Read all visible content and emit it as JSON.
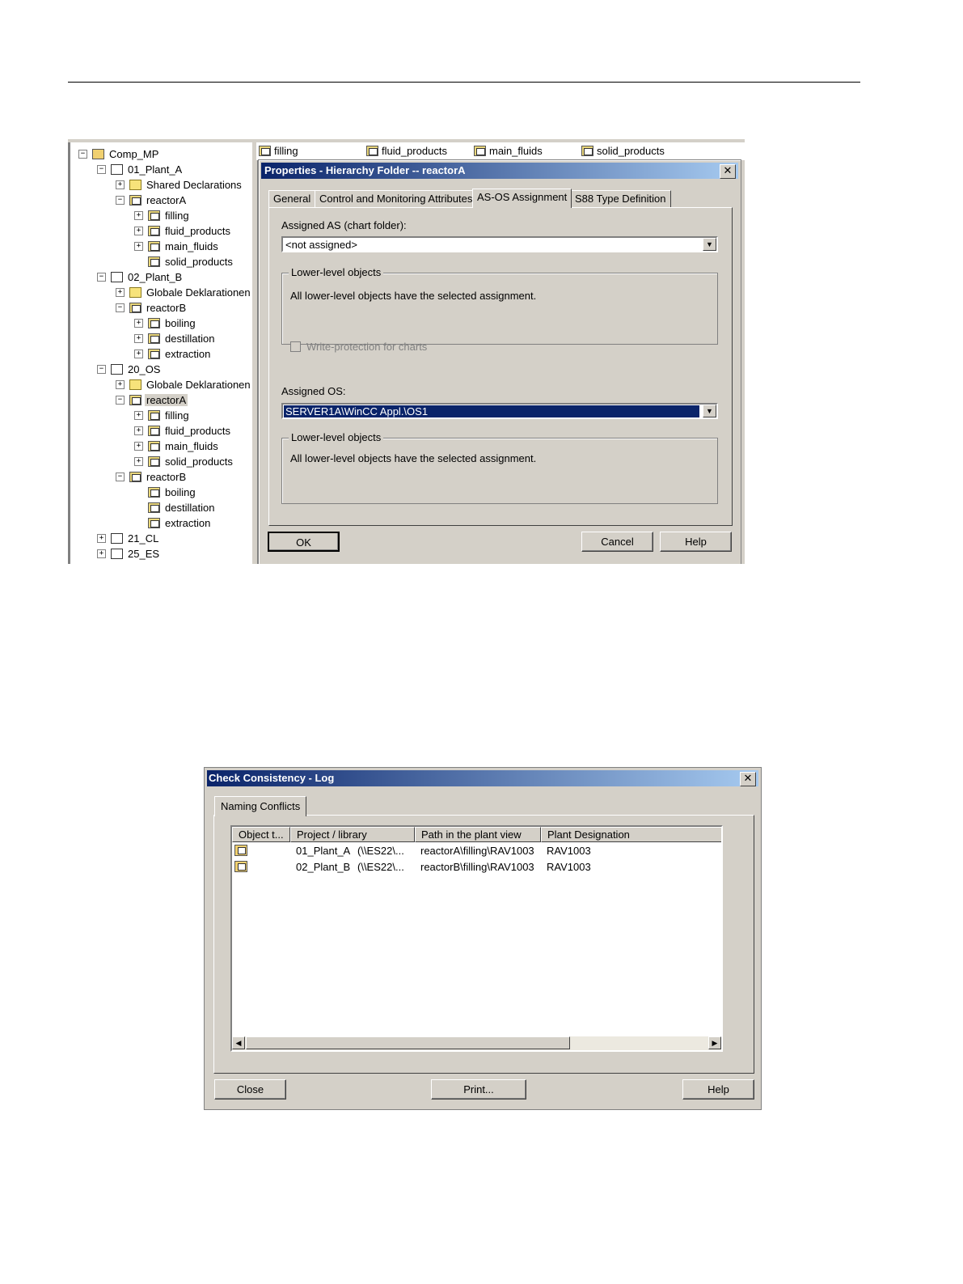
{
  "tree": {
    "items": [
      {
        "label": "Comp_MP",
        "level": 0,
        "toggle": "−",
        "icon": "project"
      },
      {
        "label": "01_Plant_A",
        "level": 1,
        "toggle": "−",
        "icon": "plant"
      },
      {
        "label": "Shared Declarations",
        "level": 2,
        "toggle": "+",
        "icon": "folder"
      },
      {
        "label": "reactorA",
        "level": 2,
        "toggle": "−",
        "icon": "h"
      },
      {
        "label": "filling",
        "level": 3,
        "toggle": "+",
        "icon": "h"
      },
      {
        "label": "fluid_products",
        "level": 3,
        "toggle": "+",
        "icon": "h"
      },
      {
        "label": "main_fluids",
        "level": 3,
        "toggle": "+",
        "icon": "h"
      },
      {
        "label": "solid_products",
        "level": 3,
        "toggle": "",
        "icon": "h"
      },
      {
        "label": "02_Plant_B",
        "level": 1,
        "toggle": "−",
        "icon": "plant"
      },
      {
        "label": "Globale Deklarationen",
        "level": 2,
        "toggle": "+",
        "icon": "folder"
      },
      {
        "label": "reactorB",
        "level": 2,
        "toggle": "−",
        "icon": "h"
      },
      {
        "label": "boiling",
        "level": 3,
        "toggle": "+",
        "icon": "h"
      },
      {
        "label": "destillation",
        "level": 3,
        "toggle": "+",
        "icon": "h"
      },
      {
        "label": "extraction",
        "level": 3,
        "toggle": "+",
        "icon": "h"
      },
      {
        "label": "20_OS",
        "level": 1,
        "toggle": "−",
        "icon": "plant"
      },
      {
        "label": "Globale Deklarationen",
        "level": 2,
        "toggle": "+",
        "icon": "folder"
      },
      {
        "label": "reactorA",
        "level": 2,
        "toggle": "−",
        "icon": "h",
        "selected": true
      },
      {
        "label": "filling",
        "level": 3,
        "toggle": "+",
        "icon": "h"
      },
      {
        "label": "fluid_products",
        "level": 3,
        "toggle": "+",
        "icon": "h"
      },
      {
        "label": "main_fluids",
        "level": 3,
        "toggle": "+",
        "icon": "h"
      },
      {
        "label": "solid_products",
        "level": 3,
        "toggle": "+",
        "icon": "h"
      },
      {
        "label": "reactorB",
        "level": 2,
        "toggle": "−",
        "icon": "h"
      },
      {
        "label": "boiling",
        "level": 3,
        "toggle": "",
        "icon": "h"
      },
      {
        "label": "destillation",
        "level": 3,
        "toggle": "",
        "icon": "h"
      },
      {
        "label": "extraction",
        "level": 3,
        "toggle": "",
        "icon": "h"
      },
      {
        "label": "21_CL",
        "level": 1,
        "toggle": "+",
        "icon": "plant"
      },
      {
        "label": "25_ES",
        "level": 1,
        "toggle": "+",
        "icon": "plant"
      }
    ]
  },
  "content_header": [
    "filling",
    "fluid_products",
    "main_fluids",
    "solid_products"
  ],
  "properties_dialog": {
    "title": "Properties - Hierarchy Folder -- reactorA",
    "close": "✕",
    "tabs": [
      "General",
      "Control and Monitoring Attributes",
      "AS-OS Assignment",
      "S88 Type Definition"
    ],
    "active_tab": 2,
    "assigned_as_label": "Assigned AS (chart folder):",
    "assigned_as_value": "<not assigned>",
    "group1_title": "Lower-level objects",
    "group1_text": "All lower-level objects have the selected assignment.",
    "write_protection_label": "Write-protection for charts",
    "assigned_os_label": "Assigned OS:",
    "assigned_os_value": "SERVER1A\\WinCC Appl.\\OS1",
    "group2_title": "Lower-level objects",
    "group2_text": "All lower-level objects have the selected assignment.",
    "ok": "OK",
    "cancel": "Cancel",
    "help": "Help"
  },
  "log_dialog": {
    "title": "Check Consistency - Log",
    "close": "✕",
    "tab": "Naming Conflicts",
    "columns": [
      "Object t...",
      "Project / library",
      "Path in the plant view",
      "Plant Designation"
    ],
    "rows": [
      {
        "project": "01_Plant_A",
        "library": "(\\\\ES22\\...",
        "path": "reactorA\\filling\\RAV1003",
        "designation": "RAV1003"
      },
      {
        "project": "02_Plant_B",
        "library": "(\\\\ES22\\...",
        "path": "reactorB\\filling\\RAV1003",
        "designation": "RAV1003"
      }
    ],
    "close_button": "Close",
    "print_button": "Print...",
    "help_button": "Help"
  }
}
